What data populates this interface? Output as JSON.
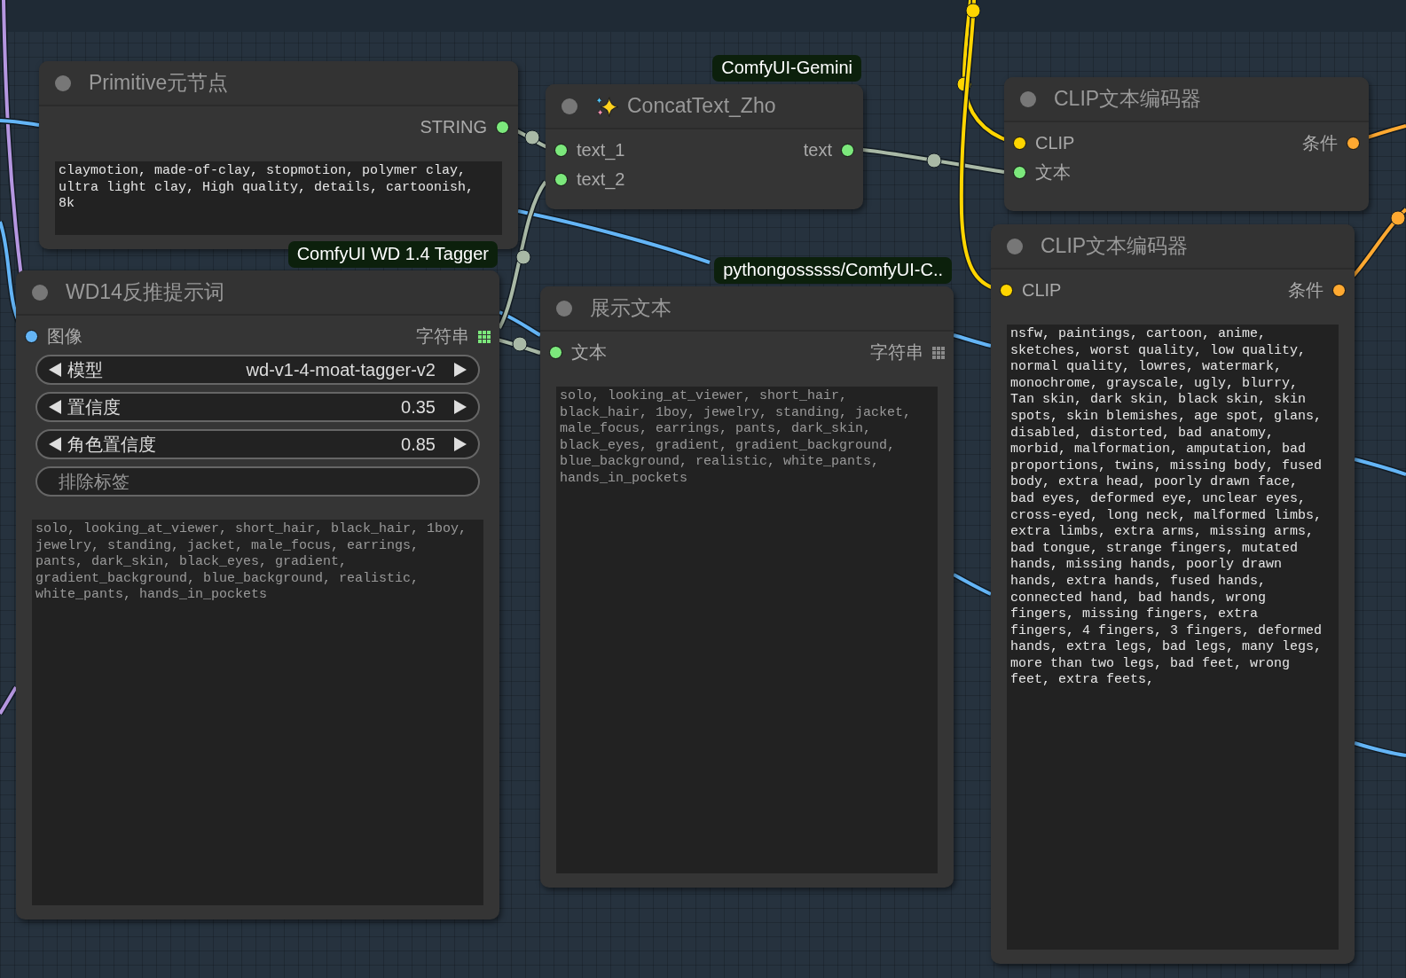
{
  "nodes": [
    {
      "title": "Primitive元节点",
      "title_icon": false,
      "outputs": [
        {
          "label": "STRING",
          "color": "#7ce87c",
          "kind": "dot"
        }
      ],
      "widgets": [
        {
          "kind": "textarea",
          "text": "claymotion, made-of-clay, stopmotion, polymer clay, ultra light clay, High quality, details, cartoonish, 8k",
          "readonly": false
        }
      ]
    },
    {
      "title": "ConcatText_Zho",
      "badge": "ComfyUI-Gemini",
      "title_icon": true,
      "inputs": [
        {
          "label": "text_1",
          "color": "#7ce87c",
          "kind": "dot"
        },
        {
          "label": "text_2",
          "color": "#7ce87c",
          "kind": "dot"
        }
      ],
      "outputs": [
        {
          "label": "text",
          "color": "#7ce87c",
          "kind": "dot"
        }
      ]
    },
    {
      "title": "WD14反推提示词",
      "badge": "ComfyUI WD 1.4 Tagger",
      "title_icon": false,
      "inputs": [
        {
          "label": "图像",
          "color": "#64b5f6",
          "kind": "dot"
        }
      ],
      "outputs": [
        {
          "label": "字符串",
          "color": "#7ce87c",
          "kind": "grid"
        }
      ],
      "widgets": [
        {
          "kind": "combo",
          "label": "模型",
          "value": "wd-v1-4-moat-tagger-v2"
        },
        {
          "kind": "combo",
          "label": "置信度",
          "value": "0.35"
        },
        {
          "kind": "combo",
          "label": "角色置信度",
          "value": "0.85"
        },
        {
          "kind": "text_input",
          "label": "排除标签"
        },
        {
          "kind": "textarea",
          "text": "solo, looking_at_viewer, short_hair, black_hair, 1boy, jewelry, standing, jacket, male_focus, earrings, pants, dark_skin, black_eyes, gradient, gradient_background, blue_background, realistic, white_pants, hands_in_pockets",
          "readonly": true
        }
      ]
    },
    {
      "title": "展示文本",
      "badge": "pythongosssss/ComfyUI-C..",
      "title_icon": false,
      "inputs": [
        {
          "label": "文本",
          "color": "#7ce87c",
          "kind": "dot"
        }
      ],
      "outputs": [
        {
          "label": "字符串",
          "color": "#8a8a8a",
          "kind": "grid"
        }
      ],
      "widgets": [
        {
          "kind": "textarea",
          "text": "solo, looking_at_viewer, short_hair, black_hair, 1boy, jewelry, standing, jacket, male_focus, earrings, pants, dark_skin, black_eyes, gradient, gradient_background, blue_background, realistic, white_pants, hands_in_pockets",
          "readonly": true
        }
      ]
    },
    {
      "title": "CLIP文本编码器",
      "title_icon": false,
      "inputs": [
        {
          "label": "CLIP",
          "color": "#ffd500",
          "kind": "dot"
        },
        {
          "label": "文本",
          "color": "#7ce87c",
          "kind": "dot"
        }
      ],
      "outputs": [
        {
          "label": "条件",
          "color": "#ffa931",
          "kind": "dot"
        }
      ]
    },
    {
      "title": "CLIP文本编码器",
      "title_icon": false,
      "inputs": [
        {
          "label": "CLIP",
          "color": "#ffd500",
          "kind": "dot"
        }
      ],
      "outputs": [
        {
          "label": "条件",
          "color": "#ffa931",
          "kind": "dot"
        }
      ],
      "widgets": [
        {
          "kind": "textarea",
          "text": "nsfw, paintings, cartoon, anime, sketches, worst quality, low quality, normal quality, lowres, watermark, monochrome, grayscale, ugly, blurry, Tan skin, dark skin, black skin, skin spots, skin blemishes, age spot, glans, disabled, distorted, bad anatomy, morbid, malformation, amputation, bad proportions, twins, missing body, fused body, extra head, poorly drawn face, bad eyes, deformed eye, unclear eyes, cross-eyed, long neck, malformed limbs, extra limbs, extra arms, missing arms, bad tongue, strange fingers, mutated hands, missing hands, poorly drawn hands, extra hands, fused hands, connected hand, bad hands, wrong fingers, missing fingers, extra fingers, 4 fingers, 3 fingers, deformed hands, extra legs, bad legs, many legs, more than two legs, bad feet, wrong feet, extra feets,",
          "readonly": false
        }
      ]
    }
  ]
}
